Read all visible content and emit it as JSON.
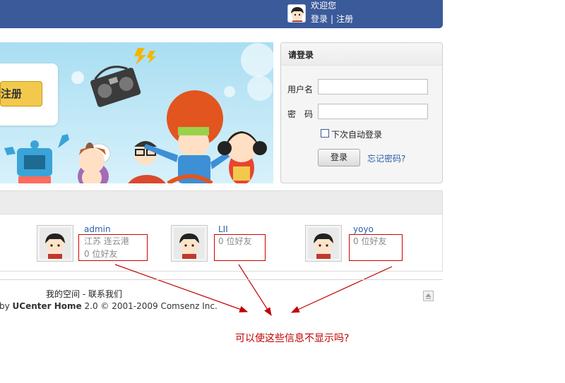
{
  "header": {
    "welcome": "欢迎您",
    "login_link": "登录",
    "separator": "|",
    "register_link": "注册"
  },
  "banner": {
    "register_button": "注册"
  },
  "login": {
    "title": "请登录",
    "username_label": "用户名",
    "password_label": "密　码",
    "username_value": "",
    "password_value": "",
    "remember_label": "下次自动登录",
    "submit_label": "登录",
    "forgot_label": "忘记密码?"
  },
  "members": [
    {
      "name": "admin",
      "location": "江苏 连云港",
      "friends": "0 位好友"
    },
    {
      "name": "LII",
      "location": "",
      "friends": "0 位好友"
    },
    {
      "name": "yoyo",
      "location": "",
      "friends": "0 位好友"
    }
  ],
  "footer": {
    "my_space": "我的空间",
    "dash": "-",
    "contact": "联系我们",
    "powered_prefix": "by",
    "product": "UCenter Home",
    "version": "2.0 © 2001-2009 Comsenz Inc."
  },
  "annotation": {
    "question": "可以使这些信息不显示吗?"
  },
  "colors": {
    "header_bg": "#3b5a9a",
    "link": "#2b5ea8",
    "annotation_red": "#c00000"
  }
}
